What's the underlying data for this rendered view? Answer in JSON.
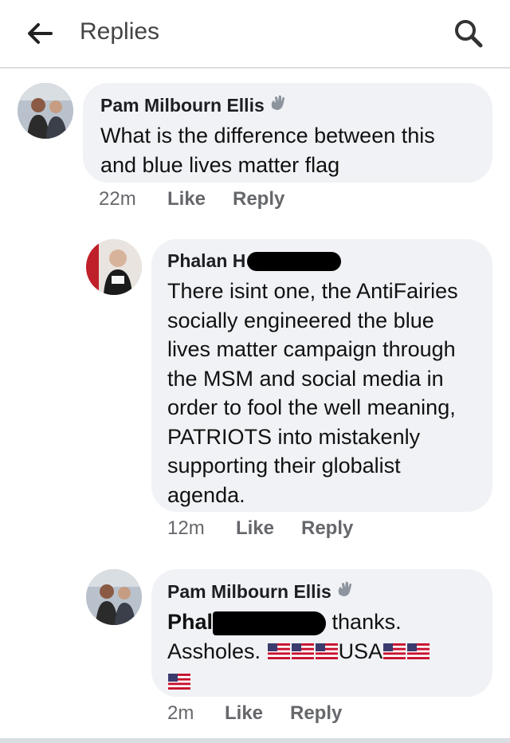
{
  "header": {
    "title": "Replies"
  },
  "comments": [
    {
      "author": "Pam Milbourn Ellis",
      "text": "What is the difference between this and blue lives matter flag",
      "time": "22m",
      "like": "Like",
      "reply": "Reply"
    },
    {
      "author_visible": "Phalan H",
      "text": "There isint one, the AntiFairies socially engineered the blue lives matter campaign through the MSM and social media  in order to fool the well meaning, PATRIOTS into mistakenly supporting their globalist agenda.",
      "time": "12m",
      "like": "Like",
      "reply": "Reply"
    },
    {
      "author": "Pam Milbourn Ellis",
      "mention_visible": "Phal",
      "text_after_mention": " thanks.",
      "text_line2": "Assholes. ",
      "usa": "USA",
      "time": "2m",
      "like": "Like",
      "reply": "Reply"
    }
  ]
}
